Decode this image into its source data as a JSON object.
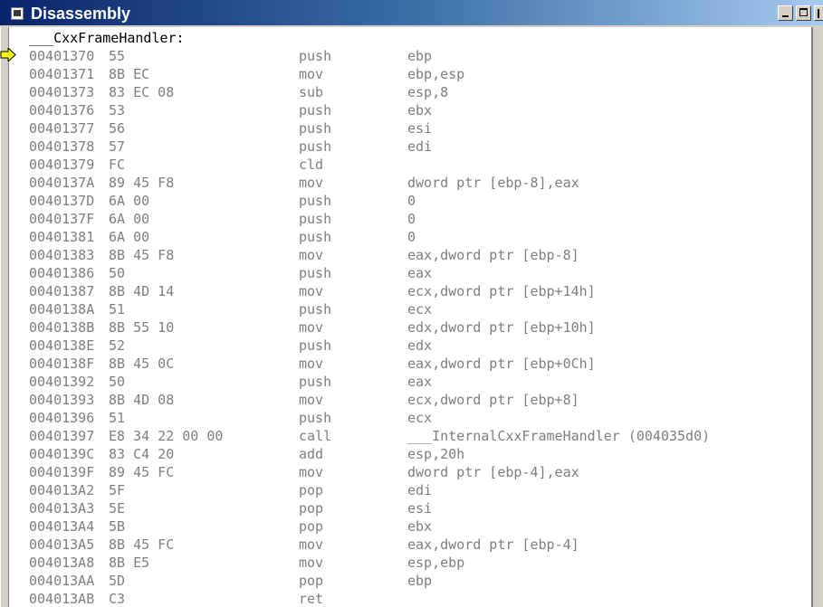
{
  "window": {
    "title": "Disassembly",
    "icon": "disassembly-window-icon",
    "caption_buttons": [
      "minimize",
      "maximize",
      "close"
    ]
  },
  "disassembly": {
    "function_label": "___CxxFrameHandler:",
    "current_instruction_marker": {
      "icon": "current-instruction-arrow-icon",
      "color": "#ffff00",
      "line_address": "00401370"
    },
    "colors": {
      "code_text": "#7f7f7f",
      "label_text": "#000000",
      "title_gradient_start": "#0a246a",
      "title_gradient_end": "#a6caf0"
    },
    "lines": [
      {
        "address": "00401370",
        "bytes": "55",
        "mnemonic": "push",
        "operands": "ebp"
      },
      {
        "address": "00401371",
        "bytes": "8B EC",
        "mnemonic": "mov",
        "operands": "ebp,esp"
      },
      {
        "address": "00401373",
        "bytes": "83 EC 08",
        "mnemonic": "sub",
        "operands": "esp,8"
      },
      {
        "address": "00401376",
        "bytes": "53",
        "mnemonic": "push",
        "operands": "ebx"
      },
      {
        "address": "00401377",
        "bytes": "56",
        "mnemonic": "push",
        "operands": "esi"
      },
      {
        "address": "00401378",
        "bytes": "57",
        "mnemonic": "push",
        "operands": "edi"
      },
      {
        "address": "00401379",
        "bytes": "FC",
        "mnemonic": "cld",
        "operands": ""
      },
      {
        "address": "0040137A",
        "bytes": "89 45 F8",
        "mnemonic": "mov",
        "operands": "dword ptr [ebp-8],eax"
      },
      {
        "address": "0040137D",
        "bytes": "6A 00",
        "mnemonic": "push",
        "operands": "0"
      },
      {
        "address": "0040137F",
        "bytes": "6A 00",
        "mnemonic": "push",
        "operands": "0"
      },
      {
        "address": "00401381",
        "bytes": "6A 00",
        "mnemonic": "push",
        "operands": "0"
      },
      {
        "address": "00401383",
        "bytes": "8B 45 F8",
        "mnemonic": "mov",
        "operands": "eax,dword ptr [ebp-8]"
      },
      {
        "address": "00401386",
        "bytes": "50",
        "mnemonic": "push",
        "operands": "eax"
      },
      {
        "address": "00401387",
        "bytes": "8B 4D 14",
        "mnemonic": "mov",
        "operands": "ecx,dword ptr [ebp+14h]"
      },
      {
        "address": "0040138A",
        "bytes": "51",
        "mnemonic": "push",
        "operands": "ecx"
      },
      {
        "address": "0040138B",
        "bytes": "8B 55 10",
        "mnemonic": "mov",
        "operands": "edx,dword ptr [ebp+10h]"
      },
      {
        "address": "0040138E",
        "bytes": "52",
        "mnemonic": "push",
        "operands": "edx"
      },
      {
        "address": "0040138F",
        "bytes": "8B 45 0C",
        "mnemonic": "mov",
        "operands": "eax,dword ptr [ebp+0Ch]"
      },
      {
        "address": "00401392",
        "bytes": "50",
        "mnemonic": "push",
        "operands": "eax"
      },
      {
        "address": "00401393",
        "bytes": "8B 4D 08",
        "mnemonic": "mov",
        "operands": "ecx,dword ptr [ebp+8]"
      },
      {
        "address": "00401396",
        "bytes": "51",
        "mnemonic": "push",
        "operands": "ecx"
      },
      {
        "address": "00401397",
        "bytes": "E8 34 22 00 00",
        "mnemonic": "call",
        "operands": "___InternalCxxFrameHandler (004035d0)"
      },
      {
        "address": "0040139C",
        "bytes": "83 C4 20",
        "mnemonic": "add",
        "operands": "esp,20h"
      },
      {
        "address": "0040139F",
        "bytes": "89 45 FC",
        "mnemonic": "mov",
        "operands": "dword ptr [ebp-4],eax"
      },
      {
        "address": "004013A2",
        "bytes": "5F",
        "mnemonic": "pop",
        "operands": "edi"
      },
      {
        "address": "004013A3",
        "bytes": "5E",
        "mnemonic": "pop",
        "operands": "esi"
      },
      {
        "address": "004013A4",
        "bytes": "5B",
        "mnemonic": "pop",
        "operands": "ebx"
      },
      {
        "address": "004013A5",
        "bytes": "8B 45 FC",
        "mnemonic": "mov",
        "operands": "eax,dword ptr [ebp-4]"
      },
      {
        "address": "004013A8",
        "bytes": "8B E5",
        "mnemonic": "mov",
        "operands": "esp,ebp"
      },
      {
        "address": "004013AA",
        "bytes": "5D",
        "mnemonic": "pop",
        "operands": "ebp"
      },
      {
        "address": "004013AB",
        "bytes": "C3",
        "mnemonic": "ret",
        "operands": ""
      }
    ]
  }
}
